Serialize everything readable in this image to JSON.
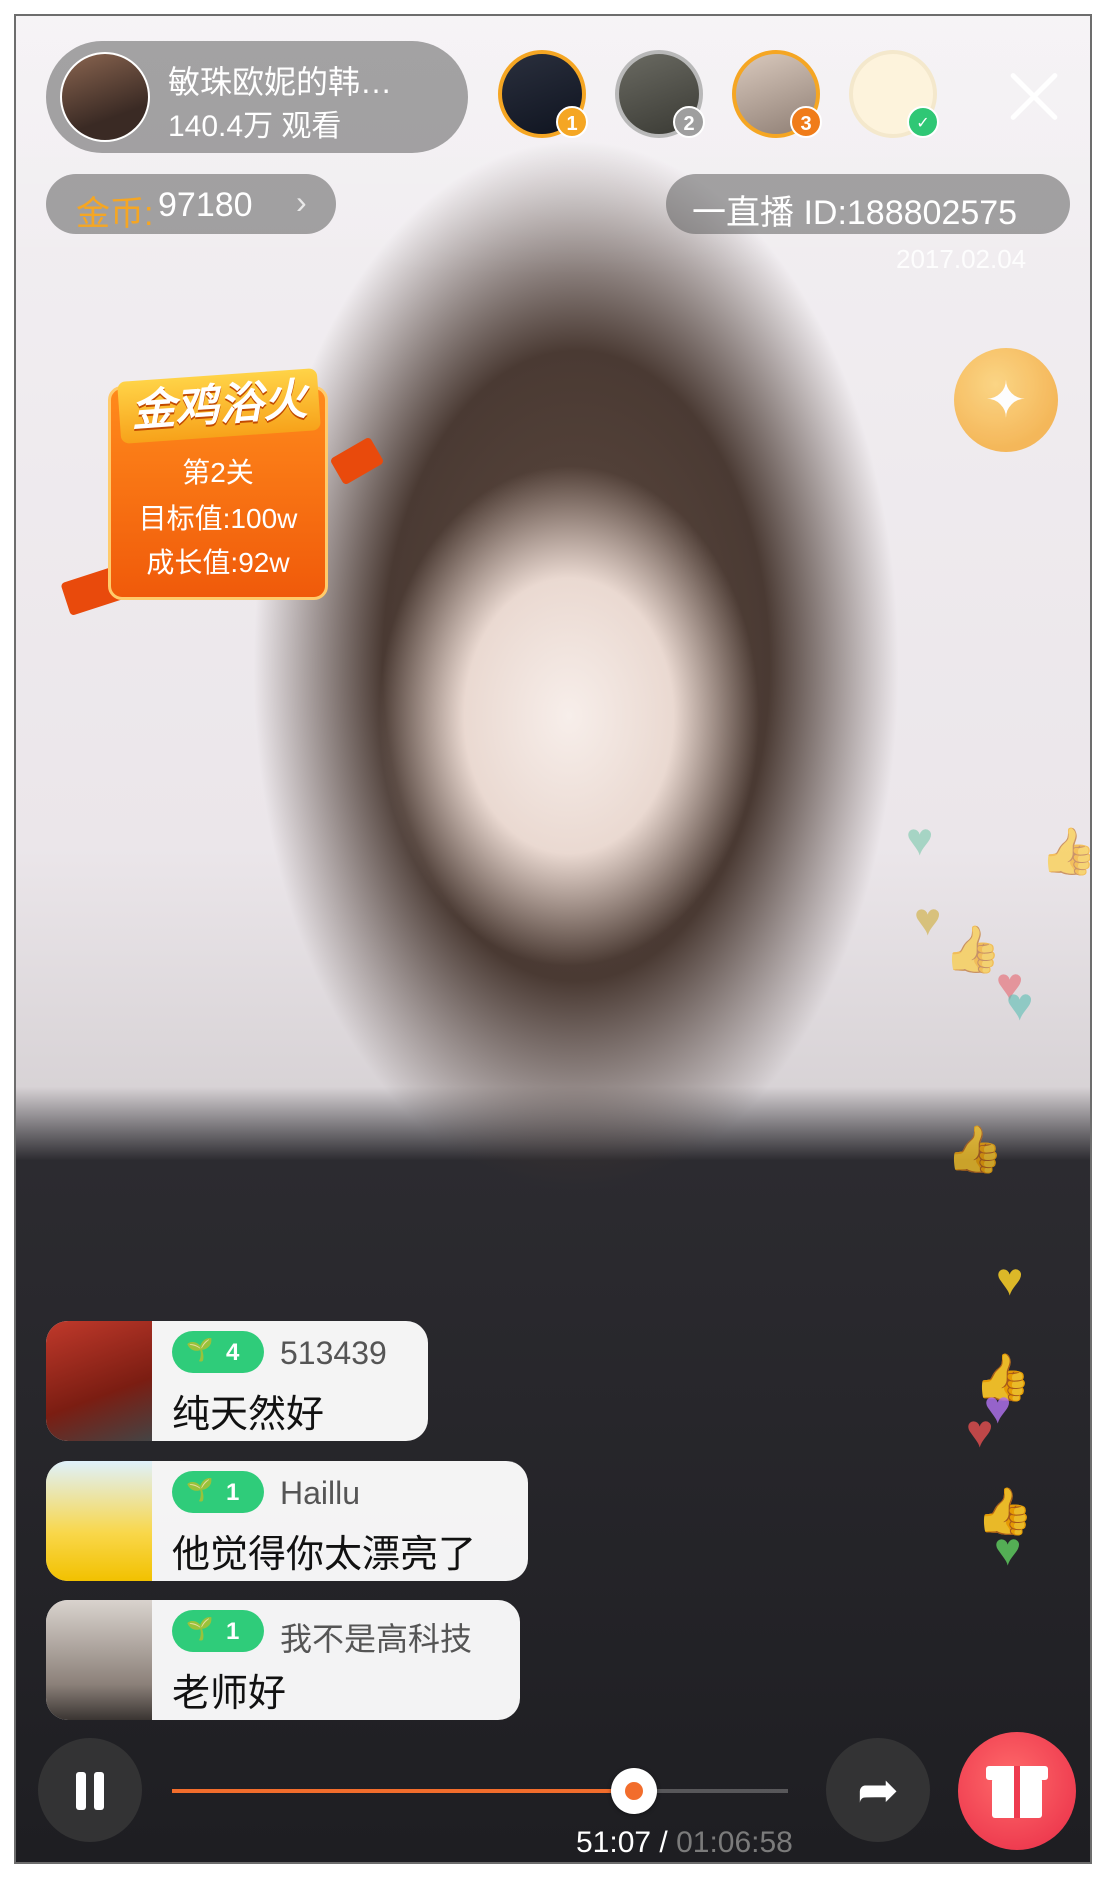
{
  "host": {
    "name": "敏珠欧妮的韩…",
    "viewers": "140.4万 观看"
  },
  "top_viewers": [
    {
      "rank": "1"
    },
    {
      "rank": "2"
    },
    {
      "rank": "3"
    },
    {
      "rank": "✓"
    }
  ],
  "coins": {
    "label": "金币:",
    "value": "97180",
    "chevron": "›"
  },
  "room": {
    "id_text": "一直播 ID:188802575",
    "date": "2017.02.04"
  },
  "event": {
    "title": "金鸡浴火",
    "level": "第2关",
    "target": "目标值:100w",
    "growth": "成长值:92w"
  },
  "chat": [
    {
      "level": "4",
      "user": "513439",
      "message": "纯天然好"
    },
    {
      "level": "1",
      "user": "Haillu",
      "message": "他觉得你太漂亮了"
    },
    {
      "level": "1",
      "user": "我不是高科技",
      "message": "老师好"
    }
  ],
  "player": {
    "current_time": "51:07",
    "separator": " / ",
    "total_time": "01:06:58",
    "progress": 0.75
  },
  "icons": {
    "pause": "pause-icon",
    "share": "share-icon",
    "gift": "gift-icon",
    "close": "close-icon",
    "wand": "magic-wand-icon"
  },
  "colors": {
    "accent_orange": "#f26d2c",
    "coin_gold": "#f5a623",
    "level_green": "#2fcc7a",
    "gift_red": "#ee3b4f"
  }
}
